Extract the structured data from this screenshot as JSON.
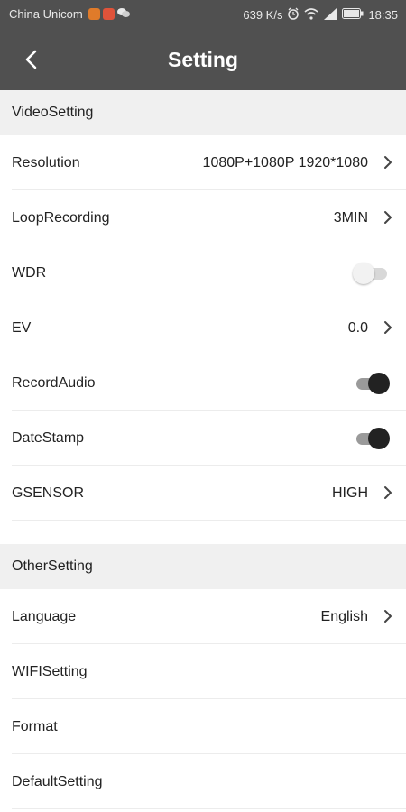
{
  "status_bar": {
    "carrier": "China Unicom",
    "speed": "639 K/s",
    "time": "18:35",
    "icons": [
      "app-badge-icon",
      "video-app-icon",
      "wechat-icon",
      "alarm-icon",
      "wifi-icon",
      "signal-icon",
      "battery-icon"
    ]
  },
  "header": {
    "title": "Setting",
    "back_icon": "back-arrow-icon"
  },
  "sections": [
    {
      "title": "VideoSetting",
      "rows": [
        {
          "label": "Resolution",
          "value": "1080P+1080P 1920*1080",
          "type": "chevron"
        },
        {
          "label": "LoopRecording",
          "value": "3MIN",
          "type": "chevron"
        },
        {
          "label": "WDR",
          "type": "toggle",
          "on": false
        },
        {
          "label": "EV",
          "value": "0.0",
          "type": "chevron"
        },
        {
          "label": "RecordAudio",
          "type": "toggle",
          "on": true
        },
        {
          "label": "DateStamp",
          "type": "toggle",
          "on": true
        },
        {
          "label": "GSENSOR",
          "value": "HIGH",
          "type": "chevron"
        }
      ]
    },
    {
      "title": "OtherSetting",
      "rows": [
        {
          "label": "Language",
          "value": "English",
          "type": "chevron"
        },
        {
          "label": "WIFISetting",
          "type": "plain"
        },
        {
          "label": "Format",
          "type": "plain"
        },
        {
          "label": "DefaultSetting",
          "type": "plain"
        }
      ]
    }
  ],
  "colors": {
    "header_bg": "#505050",
    "section_bg": "#f0f0f0",
    "toggle_on": "#222222",
    "toggle_off": "#d8d8d8"
  }
}
